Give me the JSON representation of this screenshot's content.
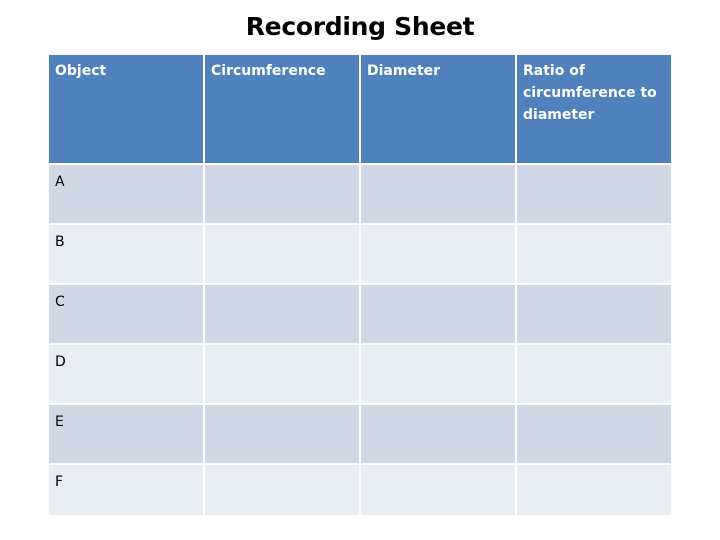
{
  "title": "Recording Sheet",
  "table": {
    "headers": [
      "Object",
      "Circumference",
      "Diameter",
      "Ratio of circumference to diameter"
    ],
    "rows": [
      {
        "object": "A",
        "circumference": "",
        "diameter": "",
        "ratio": ""
      },
      {
        "object": "B",
        "circumference": "",
        "diameter": "",
        "ratio": ""
      },
      {
        "object": "C",
        "circumference": "",
        "diameter": "",
        "ratio": ""
      },
      {
        "object": "D",
        "circumference": "",
        "diameter": "",
        "ratio": ""
      },
      {
        "object": "E",
        "circumference": "",
        "diameter": "",
        "ratio": ""
      },
      {
        "object": "F",
        "circumference": "",
        "diameter": "",
        "ratio": ""
      }
    ]
  },
  "colors": {
    "header_bg": "#4f81bd",
    "row_odd_bg": "#d0d8e8",
    "row_even_bg": "#e9edf4"
  }
}
